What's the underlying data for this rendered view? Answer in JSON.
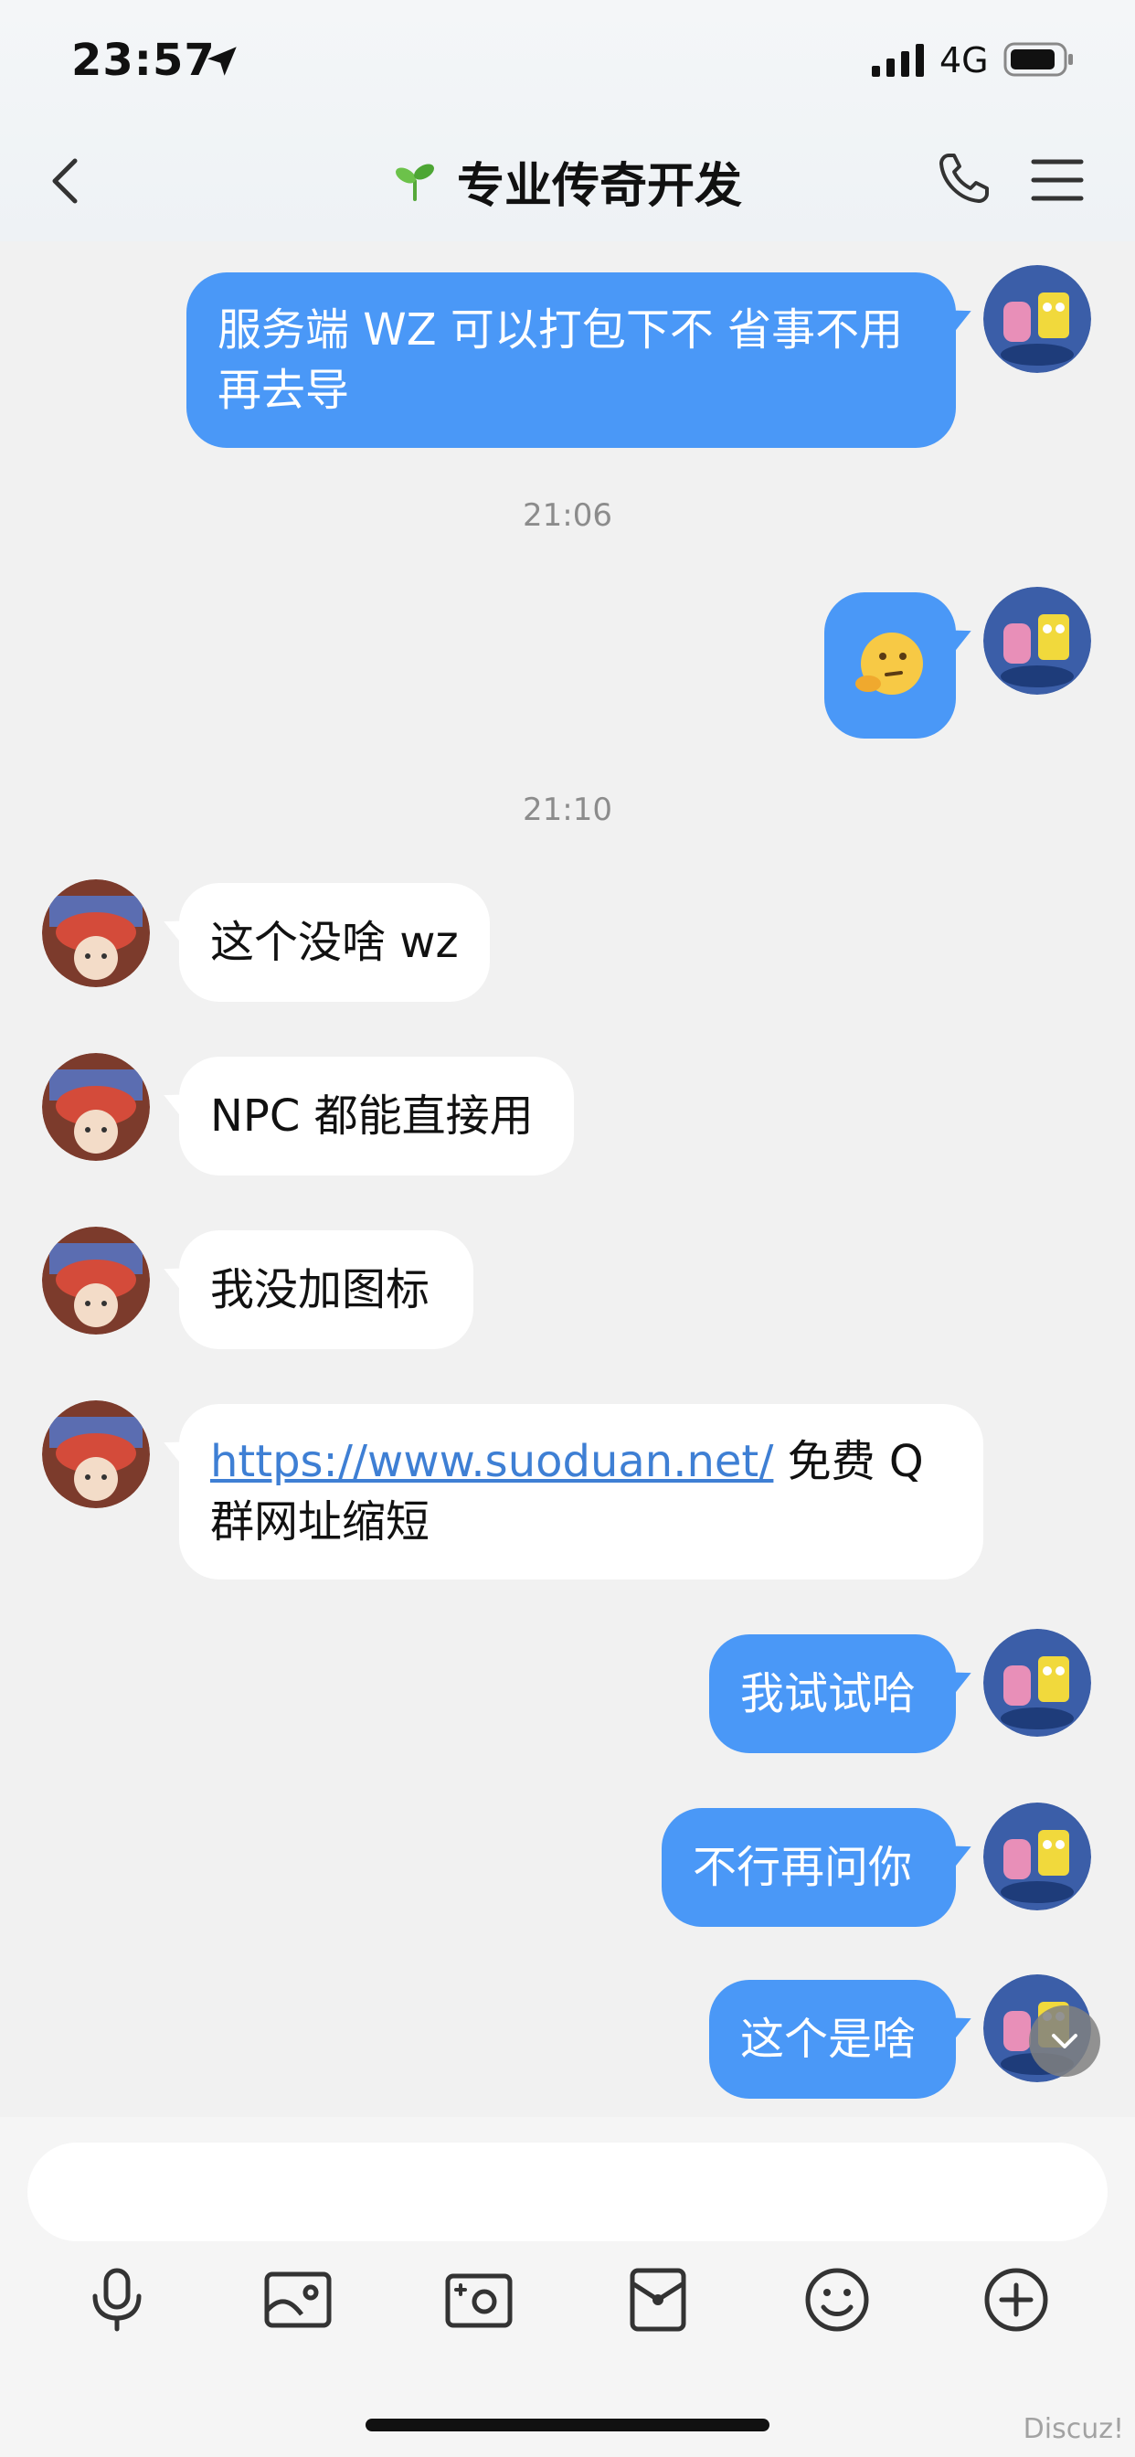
{
  "status_bar": {
    "time": "23:57",
    "network": "4G"
  },
  "header": {
    "title": "专业传奇开发"
  },
  "messages": {
    "m1": "服务端 WZ 可以打包下不 省事不用再去导",
    "t1": "21:06",
    "t2": "21:10",
    "m3": "这个没啥 wz",
    "m4": "NPC 都能直接用",
    "m5": "我没加图标",
    "m6_link": "https://www.suoduan.net/",
    "m6_text": "免费 Q 群网址缩短",
    "m7": "我试试哈",
    "m8": "不行再问你",
    "m9": "这个是啥"
  },
  "input": {
    "placeholder": ""
  },
  "toolbar_icons": [
    "mic-icon",
    "image-icon",
    "camera-icon",
    "red-packet-icon",
    "emoji-icon",
    "plus-icon"
  ],
  "watermark": "Discuz!",
  "colors": {
    "outgoing": "#4a98f7",
    "incoming": "#ffffff",
    "background": "#f1f1f1",
    "link": "#3e7fd4"
  }
}
